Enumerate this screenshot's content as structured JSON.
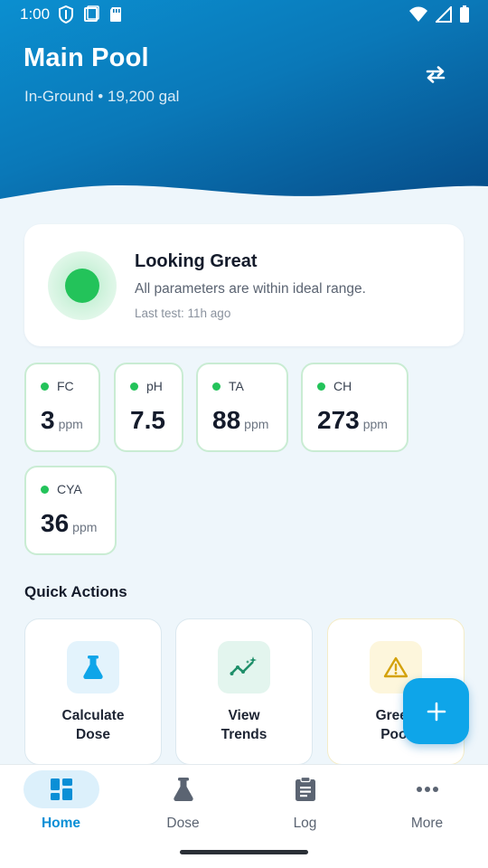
{
  "status_bar": {
    "time": "1:00"
  },
  "header": {
    "title": "Main Pool",
    "subtitle": "In-Ground • 19,200 gal",
    "switch_icon": "swap-arrows-icon"
  },
  "status_card": {
    "title": "Looking Great",
    "description": "All parameters are within ideal range.",
    "last_test": "Last test: 11h ago",
    "status_color": "#23c35a"
  },
  "parameters": [
    {
      "name": "FC",
      "value": "3",
      "unit": "ppm"
    },
    {
      "name": "pH",
      "value": "7.5",
      "unit": ""
    },
    {
      "name": "TA",
      "value": "88",
      "unit": "ppm"
    },
    {
      "name": "CH",
      "value": "273",
      "unit": "ppm"
    },
    {
      "name": "CYA",
      "value": "36",
      "unit": "ppm"
    }
  ],
  "quick_actions": {
    "title": "Quick Actions",
    "items": [
      {
        "label": "Calculate\nDose",
        "icon": "flask-icon"
      },
      {
        "label": "View\nTrends",
        "icon": "trend-chart-icon"
      },
      {
        "label": "Green\nPool",
        "icon": "warning-icon"
      }
    ]
  },
  "fab": {
    "icon": "plus-icon"
  },
  "bottom_nav": {
    "items": [
      {
        "label": "Home",
        "icon": "dashboard-icon",
        "active": true
      },
      {
        "label": "Dose",
        "icon": "flask-icon",
        "active": false
      },
      {
        "label": "Log",
        "icon": "clipboard-icon",
        "active": false
      },
      {
        "label": "More",
        "icon": "more-dots-icon",
        "active": false
      }
    ]
  },
  "colors": {
    "accent": "#0ea5e9",
    "good": "#23c35a",
    "header_dark": "#064a86"
  }
}
